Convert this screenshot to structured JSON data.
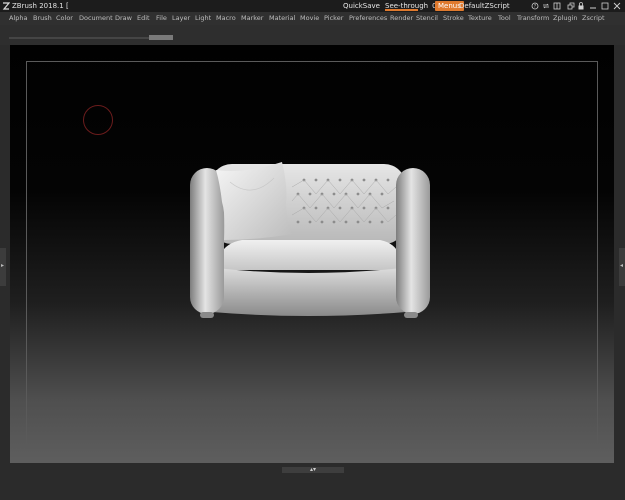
{
  "titlebar": {
    "app_title": "ZBrush 2018.1 [",
    "quicksave": "QuickSave",
    "see_through_label": "See-through",
    "see_through_value": "0",
    "see_through_level": 0,
    "menus_toggle": "Menus",
    "default_script": "DefaultZScript"
  },
  "menubar": {
    "items": [
      "Alpha",
      "Brush",
      "Color",
      "Document",
      "Draw",
      "Edit",
      "File",
      "Layer",
      "Light",
      "Macro",
      "Marker",
      "Material",
      "Movie",
      "Picker",
      "Preferences",
      "Render",
      "Stencil",
      "Stroke",
      "Texture",
      "Tool",
      "Transform",
      "Zplugin",
      "Zscript"
    ]
  },
  "colors": {
    "accent": "#e07a2e",
    "background": "#2b2b2b",
    "brush_cursor": "#6b1c1c"
  },
  "icons": {
    "logo": "zbrush-logo-icon",
    "window_controls": [
      "help-icon",
      "swap-icon",
      "layout-icon",
      "restore-icon",
      "lock-icon",
      "minimize-icon",
      "maximize-icon",
      "close-icon"
    ]
  },
  "viewport": {
    "model": "sofa"
  }
}
